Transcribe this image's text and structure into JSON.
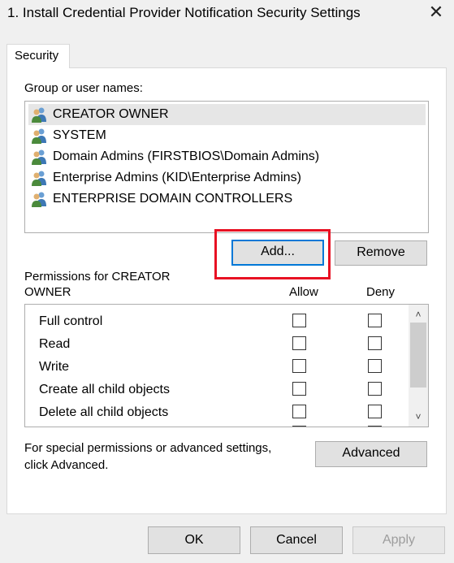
{
  "window": {
    "title": "1. Install Credential Provider Notification Security Settings",
    "close_glyph": "✕"
  },
  "tabs": [
    {
      "label": "Security"
    }
  ],
  "groups": {
    "label": "Group or user names:",
    "items": [
      {
        "label": "CREATOR OWNER",
        "icon": "users-icon",
        "selected": true
      },
      {
        "label": "SYSTEM",
        "icon": "users-icon",
        "selected": false
      },
      {
        "label": "Domain Admins (FIRSTBIOS\\Domain Admins)",
        "icon": "users-icon",
        "selected": false
      },
      {
        "label": "Enterprise Admins (KID\\Enterprise Admins)",
        "icon": "users-icon",
        "selected": false
      },
      {
        "label": "ENTERPRISE DOMAIN CONTROLLERS",
        "icon": "users-icon",
        "selected": false
      }
    ]
  },
  "buttons": {
    "add": "Add...",
    "remove": "Remove",
    "advanced": "Advanced",
    "ok": "OK",
    "cancel": "Cancel",
    "apply": "Apply"
  },
  "permissions": {
    "label_line1": "Permissions for CREATOR",
    "label_line2": "OWNER",
    "allow_header": "Allow",
    "deny_header": "Deny",
    "rows": [
      {
        "name": "Full control",
        "allow": false,
        "deny": false
      },
      {
        "name": "Read",
        "allow": false,
        "deny": false
      },
      {
        "name": "Write",
        "allow": false,
        "deny": false
      },
      {
        "name": "Create all child objects",
        "allow": false,
        "deny": false
      },
      {
        "name": "Delete all child objects",
        "allow": false,
        "deny": false
      }
    ]
  },
  "special": {
    "line1": "For special permissions or advanced settings,",
    "line2": "click Advanced."
  },
  "colors": {
    "highlight": "#e81123",
    "focus": "#0078d7"
  }
}
